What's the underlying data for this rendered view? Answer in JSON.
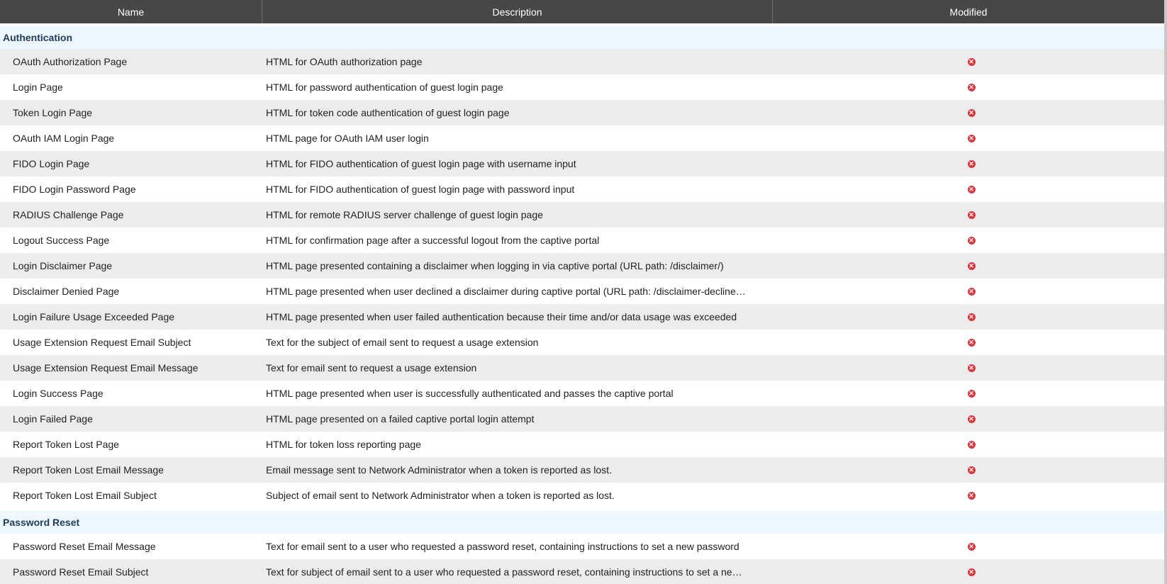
{
  "header": {
    "name": "Name",
    "description": "Description",
    "modified": "Modified"
  },
  "colors": {
    "header_bg": "#474747",
    "group_bg": "#eef6fe",
    "alt_row": "#ececec",
    "not_modified_icon": "#d9363e"
  },
  "groups": [
    {
      "title": "Authentication",
      "rows": [
        {
          "name": "OAuth Authorization Page",
          "description": "HTML for OAuth authorization page",
          "modified": false
        },
        {
          "name": "Login Page",
          "description": "HTML for password authentication of guest login page",
          "modified": false
        },
        {
          "name": "Token Login Page",
          "description": "HTML for token code authentication of guest login page",
          "modified": false
        },
        {
          "name": "OAuth IAM Login Page",
          "description": "HTML page for OAuth IAM user login",
          "modified": false
        },
        {
          "name": "FIDO Login Page",
          "description": "HTML for FIDO authentication of guest login page with username input",
          "modified": false
        },
        {
          "name": "FIDO Login Password Page",
          "description": "HTML for FIDO authentication of guest login page with password input",
          "modified": false
        },
        {
          "name": "RADIUS Challenge Page",
          "description": "HTML for remote RADIUS server challenge of guest login page",
          "modified": false
        },
        {
          "name": "Logout Success Page",
          "description": "HTML for confirmation page after a successful logout from the captive portal",
          "modified": false
        },
        {
          "name": "Login Disclaimer Page",
          "description": "HTML page presented containing a disclaimer when logging in via captive portal (URL path: /disclaimer/)",
          "modified": false
        },
        {
          "name": "Disclaimer Denied Page",
          "description": "HTML page presented when user declined a disclaimer during captive portal (URL path: /disclaimer-decline…",
          "modified": false
        },
        {
          "name": "Login Failure Usage Exceeded Page",
          "description": "HTML page presented when user failed authentication because their time and/or data usage was exceeded",
          "modified": false
        },
        {
          "name": "Usage Extension Request Email Subject",
          "description": "Text for the subject of email sent to request a usage extension",
          "modified": false
        },
        {
          "name": "Usage Extension Request Email Message",
          "description": "Text for email sent to request a usage extension",
          "modified": false
        },
        {
          "name": "Login Success Page",
          "description": "HTML page presented when user is successfully authenticated and passes the captive portal",
          "modified": false
        },
        {
          "name": "Login Failed Page",
          "description": "HTML page presented on a failed captive portal login attempt",
          "modified": false
        },
        {
          "name": "Report Token Lost Page",
          "description": "HTML for token loss reporting page",
          "modified": false
        },
        {
          "name": "Report Token Lost Email Message",
          "description": "Email message sent to Network Administrator when a token is reported as lost.",
          "modified": false
        },
        {
          "name": "Report Token Lost Email Subject",
          "description": "Subject of email sent to Network Administrator when a token is reported as lost.",
          "modified": false
        }
      ]
    },
    {
      "title": "Password Reset",
      "rows": [
        {
          "name": "Password Reset Email Message",
          "description": "Text for email sent to a user who requested a password reset, containing instructions to set a new password",
          "modified": false
        },
        {
          "name": "Password Reset Email Subject",
          "description": "Text for subject of email sent to a user who requested a password reset, containing instructions to set a ne…",
          "modified": false
        }
      ]
    }
  ]
}
